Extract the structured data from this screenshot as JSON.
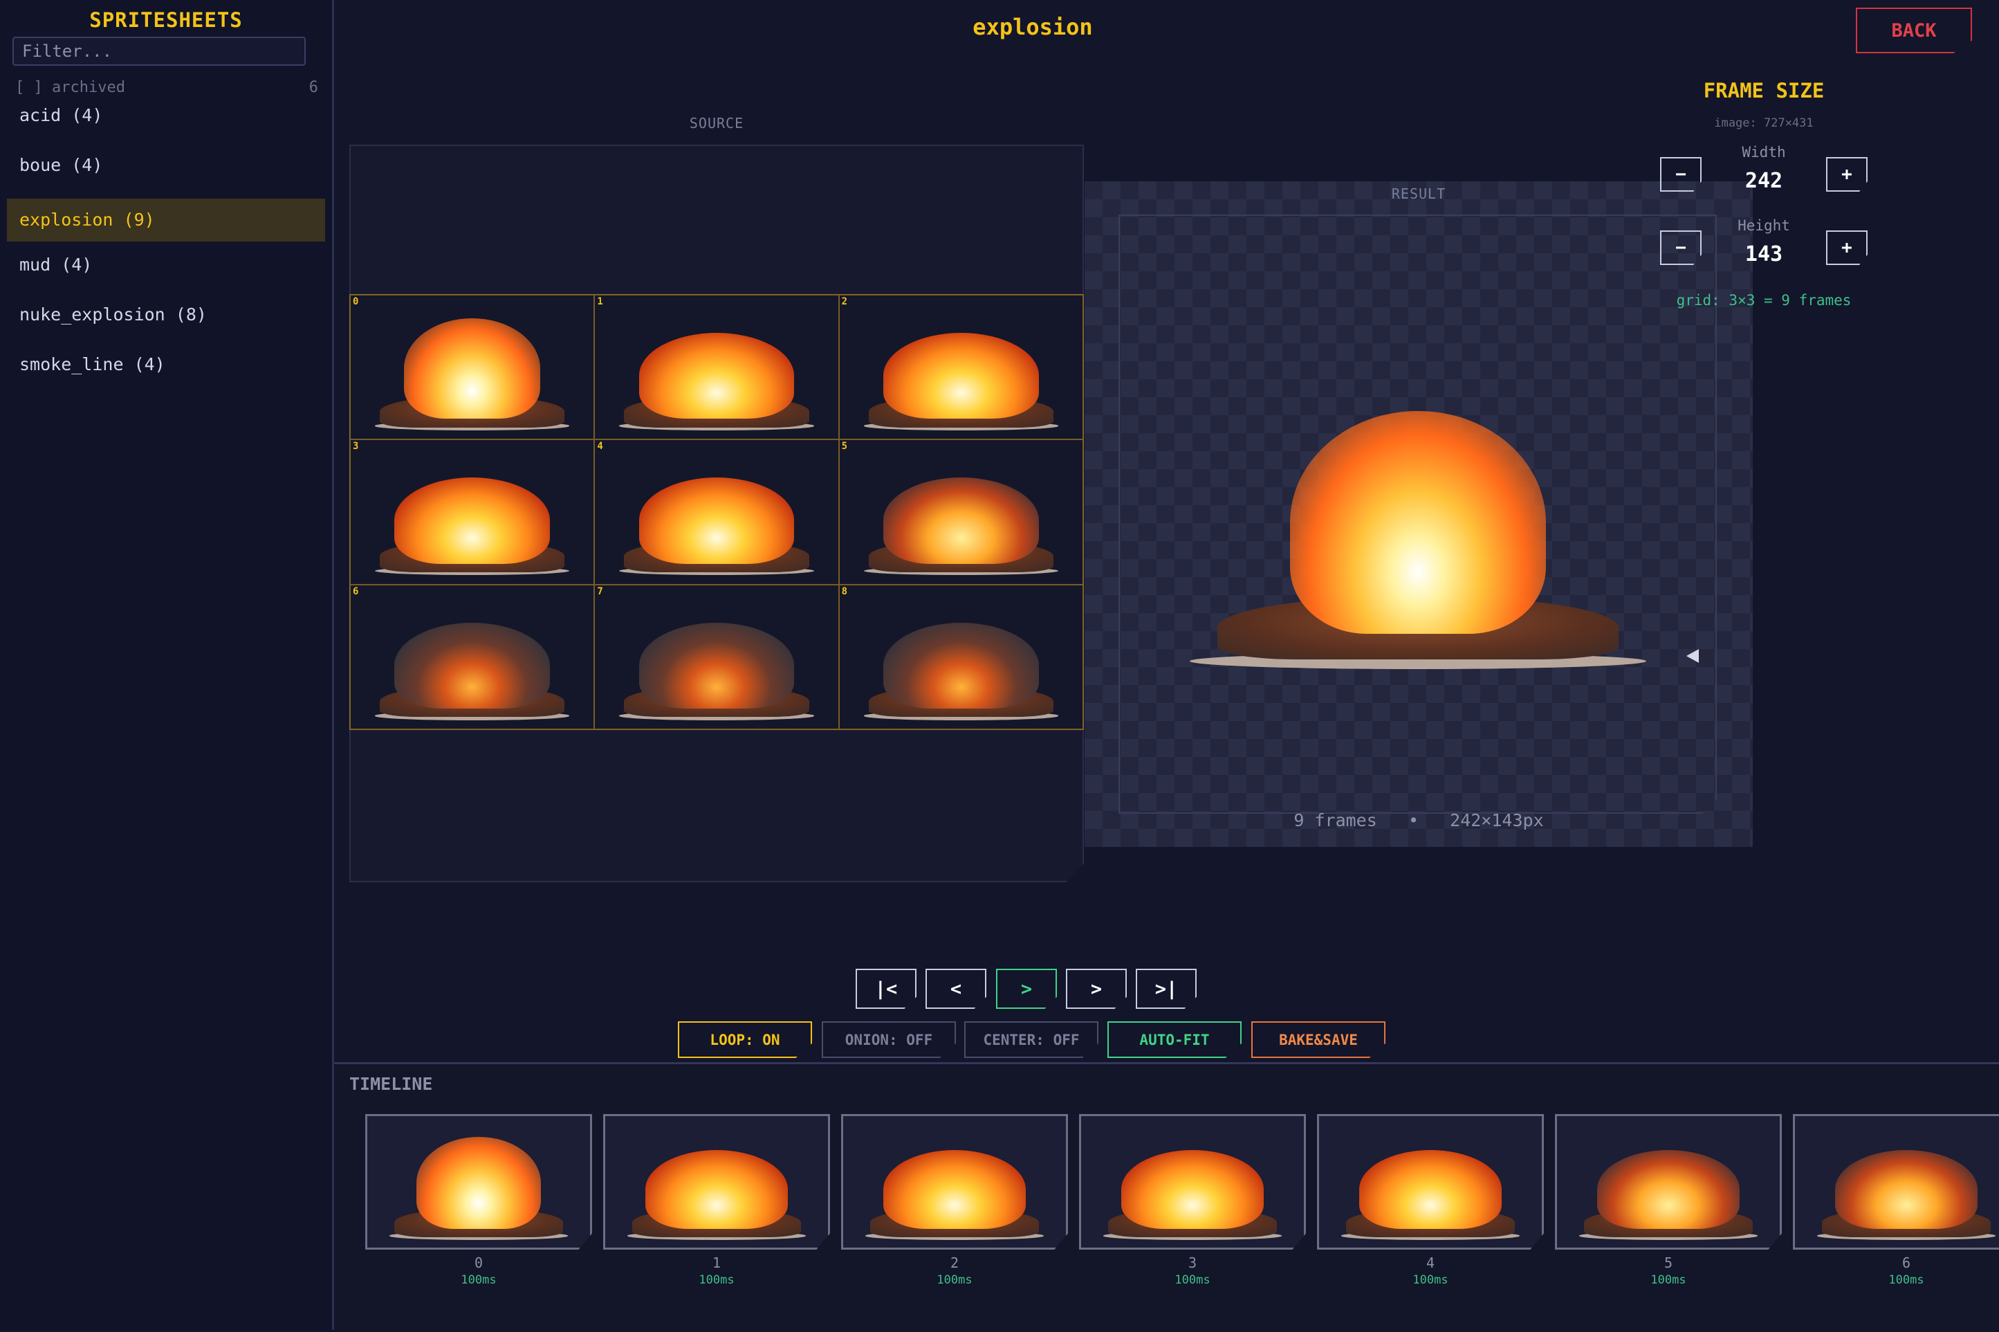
{
  "sidebar": {
    "title": "SPRITESHEETS",
    "filter_placeholder": "Filter...",
    "archived_label": "[ ] archived",
    "archived_count": "6",
    "items": [
      {
        "label": "acid (4)"
      },
      {
        "label": "boue (4)"
      },
      {
        "label": "explosion (9)",
        "active": true
      },
      {
        "label": "mud (4)"
      },
      {
        "label": "nuke_explosion (8)"
      },
      {
        "label": "smoke_line (4)"
      }
    ]
  },
  "header": {
    "title": "explosion",
    "back_label": "BACK"
  },
  "source": {
    "label": "SOURCE",
    "cells": [
      {
        "index": "0",
        "style": "burst"
      },
      {
        "index": "1",
        "style": "bright"
      },
      {
        "index": "2",
        "style": "bright"
      },
      {
        "index": "3",
        "style": "bright"
      },
      {
        "index": "4",
        "style": "bright"
      },
      {
        "index": "5",
        "style": "mid"
      },
      {
        "index": "6",
        "style": "dark"
      },
      {
        "index": "7",
        "style": "dark"
      },
      {
        "index": "8",
        "style": "dark"
      }
    ]
  },
  "result": {
    "label": "RESULT",
    "frames_text": "9 frames",
    "separator": "•",
    "size_text": "242×143px"
  },
  "frame_size": {
    "title": "FRAME SIZE",
    "image_text": "image: 727×431",
    "width_label": "Width",
    "width_value": "242",
    "height_label": "Height",
    "height_value": "143",
    "minus_label": "−",
    "plus_label": "+",
    "grid_text": "grid: 3×3 = 9 frames"
  },
  "transport": {
    "first": "|<",
    "prev": "<",
    "play": ">",
    "next": ">",
    "last": ">|"
  },
  "toggles": {
    "loop": "LOOP: ON",
    "onion": "ONION: OFF",
    "center": "CENTER: OFF",
    "autofit": "AUTO-FIT",
    "bake": "BAKE&SAVE"
  },
  "timeline": {
    "title": "TIMELINE",
    "frames": [
      {
        "index": "0",
        "duration": "100ms",
        "style": "burst"
      },
      {
        "index": "1",
        "duration": "100ms",
        "style": "bright"
      },
      {
        "index": "2",
        "duration": "100ms",
        "style": "bright"
      },
      {
        "index": "3",
        "duration": "100ms",
        "style": "bright"
      },
      {
        "index": "4",
        "duration": "100ms",
        "style": "bright"
      },
      {
        "index": "5",
        "duration": "100ms",
        "style": "mid"
      },
      {
        "index": "6",
        "duration": "100ms",
        "style": "mid"
      }
    ]
  },
  "colors": {
    "accent": "#f3c318",
    "danger": "#d8333d",
    "success": "#3fd488",
    "bake": "#e8763a",
    "background": "#13152a"
  }
}
